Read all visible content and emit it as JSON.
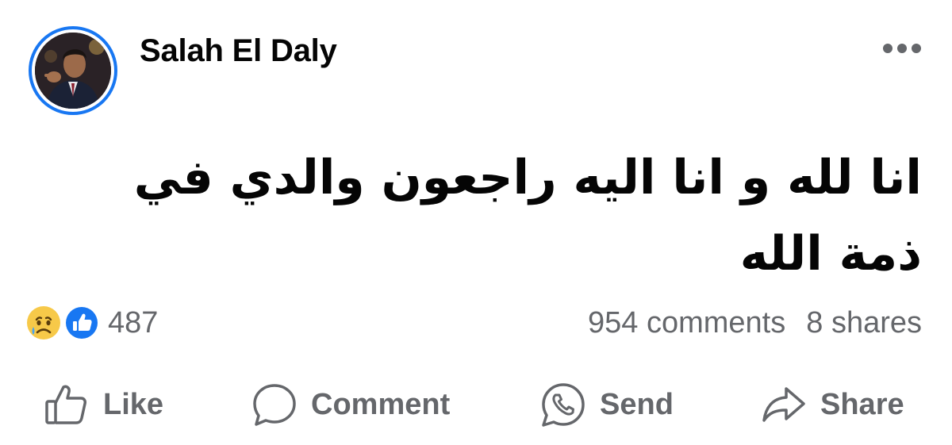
{
  "post": {
    "author": "Salah El Daly",
    "text": "انا لله و انا اليه راجعون والدي في ذمة الله",
    "reactions": {
      "icons": [
        "sad-face-icon",
        "like-icon"
      ],
      "count": "487"
    },
    "comments": "954 comments",
    "shares": "8 shares"
  },
  "actions": {
    "like": "Like",
    "comment": "Comment",
    "send": "Send",
    "share": "Share"
  },
  "colors": {
    "accent": "#1877f2",
    "secondary_text": "#65676b",
    "primary_text": "#050505",
    "sad_face": "#f7c949"
  }
}
